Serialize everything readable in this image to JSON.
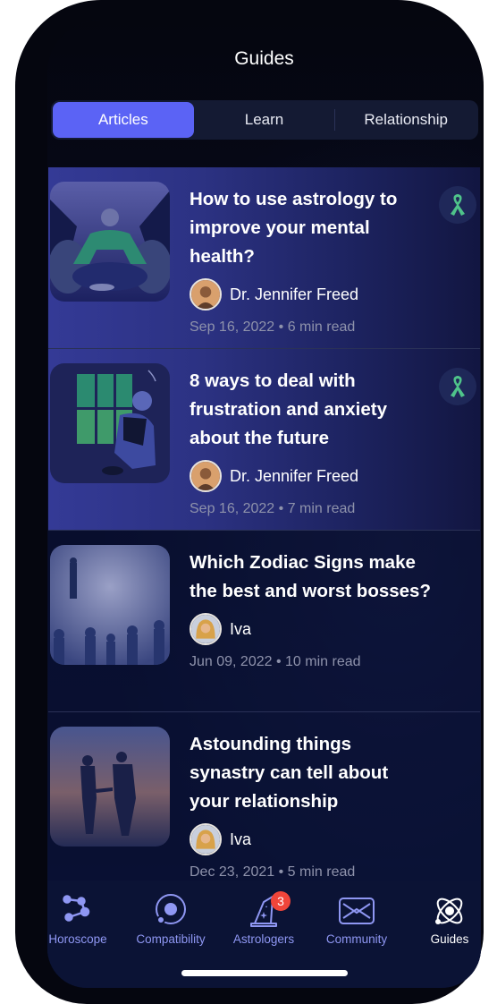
{
  "header": {
    "title": "Guides"
  },
  "segments": [
    {
      "label": "Articles",
      "active": true
    },
    {
      "label": "Learn",
      "active": false
    },
    {
      "label": "Relationship",
      "active": false
    }
  ],
  "articles": [
    {
      "title": "How to use astrology to improve your mental health?",
      "author": "Dr. Jennifer Freed",
      "date": "Sep 16, 2022",
      "read_time": "6 min read",
      "meta": "Sep 16, 2022 • 6 min read",
      "thumbnail": "meditation-illustration",
      "badge_icon": "awareness-ribbon-icon",
      "highlighted": true
    },
    {
      "title": "8 ways to deal with frustration and anxiety about the future",
      "author": "Dr. Jennifer Freed",
      "date": "Sep 16, 2022",
      "read_time": "7 min read",
      "meta": "Sep 16, 2022 • 7 min read",
      "thumbnail": "window-sitting-illustration",
      "badge_icon": "awareness-ribbon-icon",
      "highlighted": true
    },
    {
      "title": "Which Zodiac Signs make the best and worst bosses?",
      "author": "Iva",
      "date": "Jun 09, 2022",
      "read_time": "10 min read",
      "meta": "Jun 09, 2022 • 10 min read",
      "thumbnail": "crowd-silhouettes-photo",
      "highlighted": false
    },
    {
      "title": "Astounding things synastry can tell about your relationship",
      "author": "Iva",
      "date": "Dec 23, 2021",
      "read_time": "5 min read",
      "meta": "Dec 23, 2021 • 5 min read",
      "thumbnail": "couple-sunset-photo",
      "highlighted": false
    }
  ],
  "tabbar": {
    "items": [
      {
        "label": "Horoscope",
        "icon": "constellation-icon",
        "active": false
      },
      {
        "label": "Compatibility",
        "icon": "orbit-icon",
        "active": false
      },
      {
        "label": "Astrologers",
        "icon": "wizard-hat-icon",
        "active": false,
        "badge": "3"
      },
      {
        "label": "Community",
        "icon": "envelope-icon",
        "active": false
      },
      {
        "label": "Guides",
        "icon": "atom-icon",
        "active": true
      }
    ]
  },
  "colors": {
    "accent": "#5b63f5",
    "tab_inactive": "#8f97f3",
    "badge": "#f0453a",
    "ribbon": "#4fc48a",
    "background": "#050816"
  }
}
